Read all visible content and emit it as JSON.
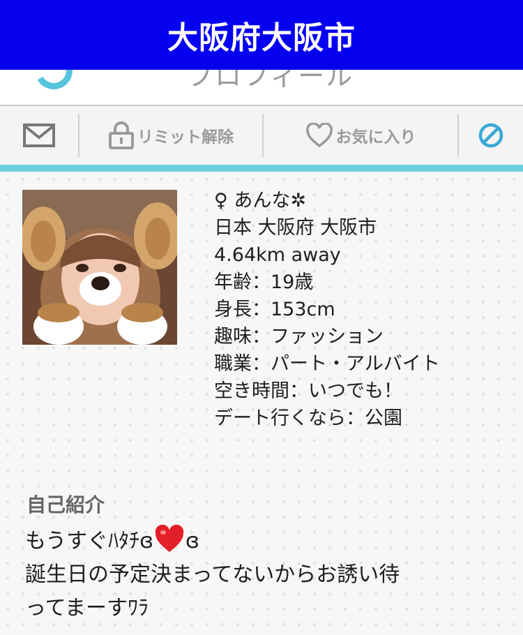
{
  "banner": {
    "text": "大阪府大阪市"
  },
  "header": {
    "title": "プロフィール",
    "logo_icon": "app-logo-icon"
  },
  "toolbar": {
    "mail": {
      "icon": "mail-icon"
    },
    "limit": {
      "icon": "lock-icon",
      "label": "リミット解除"
    },
    "favorite": {
      "icon": "heart-outline-icon",
      "label": "お気に入り"
    },
    "block": {
      "icon": "block-icon"
    }
  },
  "colors": {
    "banner_bg": "#0600f0",
    "accent": "#6ecfe0",
    "toolbar_text": "#9a9a9a",
    "heart": "#e3202a"
  },
  "profile": {
    "photo_icon": "profile-photo",
    "name_line": "♀ あんな✲",
    "location": "日本 大阪府 大阪市",
    "distance": "4.64km away",
    "age": "年齢：19歳",
    "height": "身長：153cm",
    "hobby": "趣味：ファッション",
    "job": "職業：パート・アルバイト",
    "free_time": "空き時間：いつでも！",
    "date_spot": "デート行くなら：公園"
  },
  "intro": {
    "heading": "自己紹介",
    "line1_a": "もうすぐﾊﾀﾁ",
    "line1_b": "ɞ",
    "line1_c": "ɞ",
    "line2": "誕生日の予定決まってないからお誘い待",
    "line3": "ってまーすﾜﾗ"
  }
}
